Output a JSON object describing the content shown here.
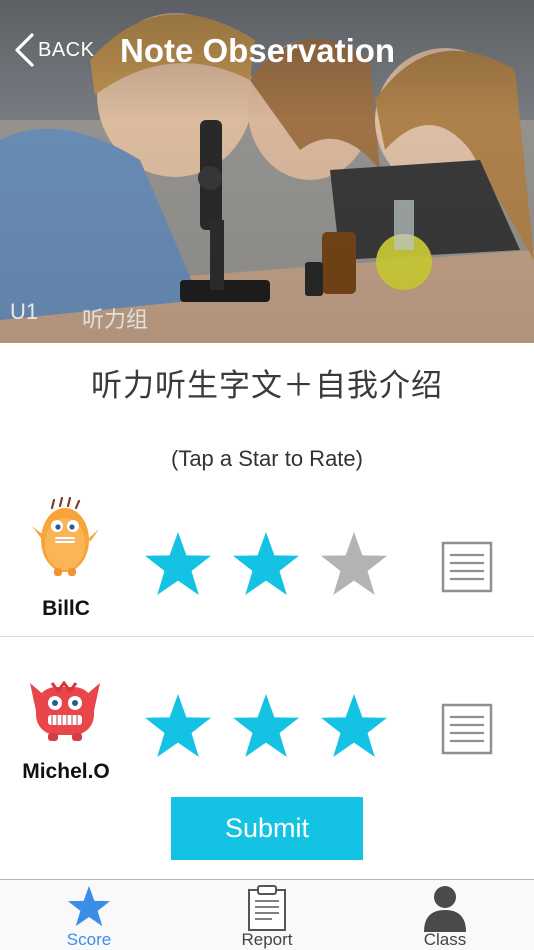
{
  "header": {
    "back_label": "BACK",
    "title": "Note Observation",
    "unit": "U1",
    "group": "听力组"
  },
  "lesson": {
    "title": "听力听生字文＋自我介绍",
    "hint": "(Tap a Star to Rate)"
  },
  "students": [
    {
      "name": "BillC",
      "rating": 2,
      "max_rating": 3,
      "avatar": "orange-monster-avatar"
    },
    {
      "name": "Michel.O",
      "rating": 3,
      "max_rating": 3,
      "avatar": "red-monster-avatar"
    }
  ],
  "submit_label": "Submit",
  "tabs": [
    {
      "label": "Score",
      "icon": "star-icon",
      "active": true
    },
    {
      "label": "Report",
      "icon": "clipboard-icon",
      "active": false
    },
    {
      "label": "Class",
      "icon": "person-icon",
      "active": false
    }
  ],
  "colors": {
    "accent": "#14c3e3",
    "star_filled": "#14c3e3",
    "star_empty": "#b3b3b3",
    "tab_active": "#3a8ee6"
  }
}
